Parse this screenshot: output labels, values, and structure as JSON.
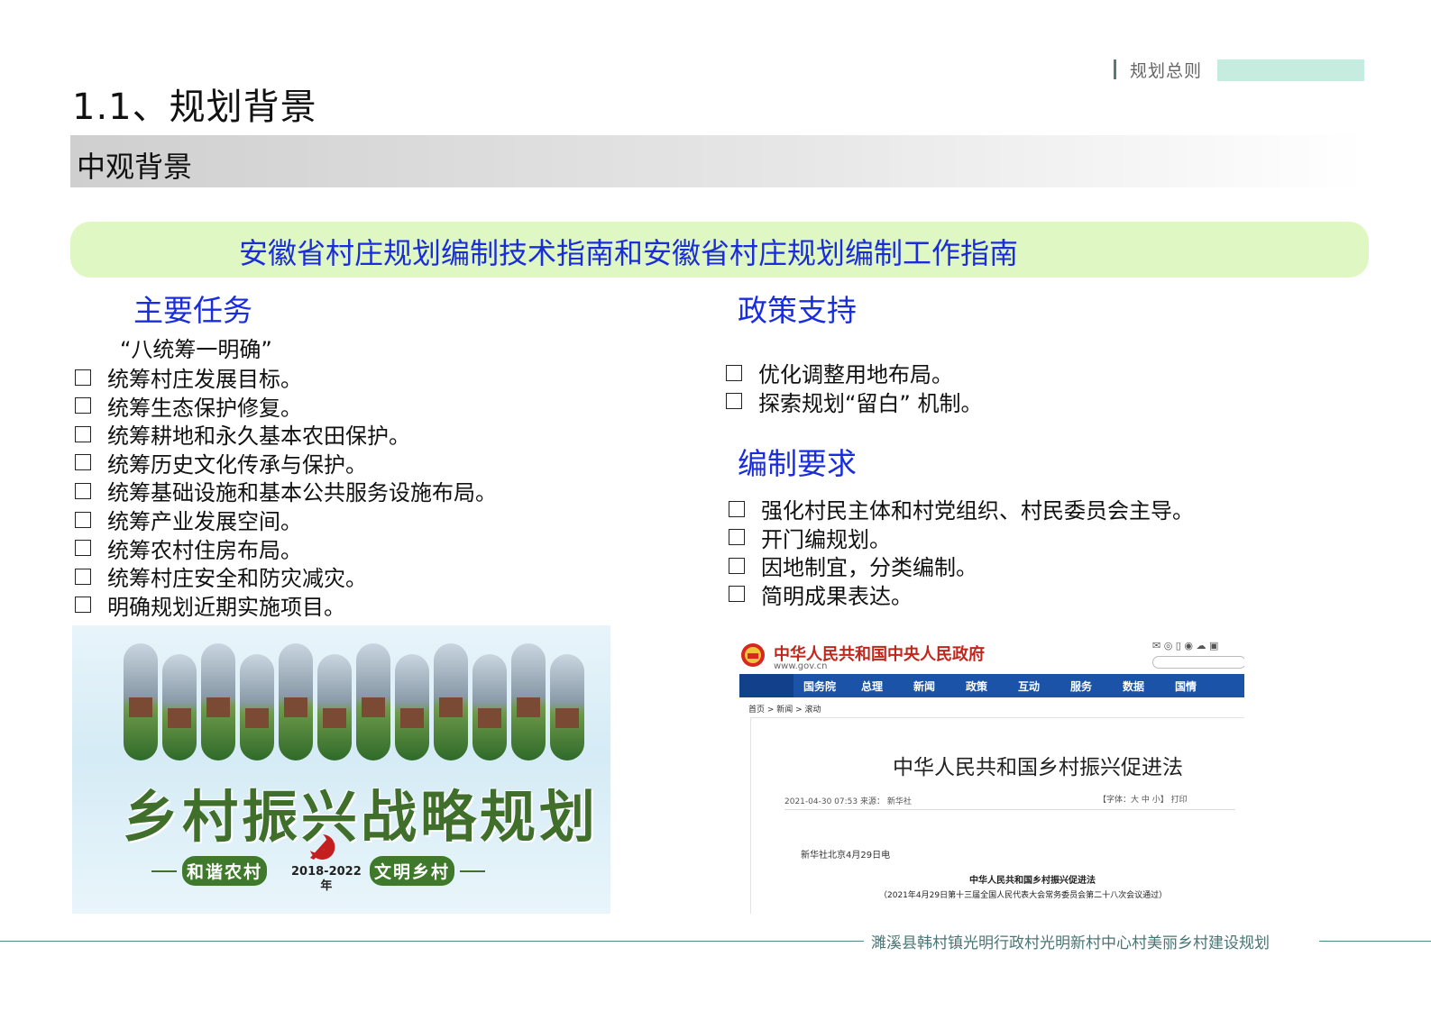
{
  "header": {
    "section_tag": "规划总则",
    "title": "1.1、规划背景",
    "subtitle": "中观背景"
  },
  "banner": {
    "text": "安徽省村庄规划编制技术指南和安徽省村庄规划编制工作指南"
  },
  "main_tasks": {
    "heading": "主要任务",
    "intro": "“八统筹一明确”",
    "items": [
      "统筹村庄发展目标。",
      "统筹生态保护修复。",
      "统筹耕地和永久基本农田保护。",
      "统筹历史文化传承与保护。",
      "统筹基础设施和基本公共服务设施布局。",
      "统筹产业发展空间。",
      "统筹农村住房布局。",
      "统筹村庄安全和防灾减灾。",
      "明确规划近期实施项目。"
    ]
  },
  "policy": {
    "heading": "政策支持",
    "items": [
      "优化调整用地布局。",
      "探索规划“留白” 机制。"
    ]
  },
  "requirements": {
    "heading": "编制要求",
    "items": [
      "强化村民主体和村党组织、村民委员会主导。",
      "开门编规划。",
      "因地制宜，分类编制。",
      "简明成果表达。"
    ]
  },
  "poster": {
    "title": "乡村振兴战略规划",
    "slogan_left": "和谐农村",
    "slogan_right": "文明乡村",
    "years": "2018-2022",
    "years_suffix": "年"
  },
  "gov_page": {
    "site_name": "中华人民共和国中央人民政府",
    "site_url": "www.gov.cn",
    "nav": [
      "国务院",
      "总理",
      "新闻",
      "政策",
      "互动",
      "服务",
      "数据",
      "国情"
    ],
    "breadcrumb": "首页  >  新闻  >  滚动",
    "article_title": "中华人民共和国乡村振兴促进法",
    "meta": "2021-04-30 07:53   来源： 新华社",
    "tools": "【字体：大 中 小】   打印",
    "dateline": "新华社北京4月29日电",
    "law_title": "中华人民共和国乡村振兴促进法",
    "law_note": "（2021年4月29日第十三届全国人民代表大会常务委员会第二十八次会议通过）"
  },
  "footer": {
    "project_name": "濉溪县韩村镇光明行政村光明新村中心村美丽乡村建设规划"
  },
  "colors": {
    "accent_blue": "#1a2ddb",
    "banner_bg": "#dff7c3",
    "tag_block": "#c6ecdf",
    "footer_teal": "#4a7575",
    "gov_red": "#c1261c",
    "gov_nav_blue": "#1a53a8",
    "poster_green": "#3f6f2a"
  }
}
